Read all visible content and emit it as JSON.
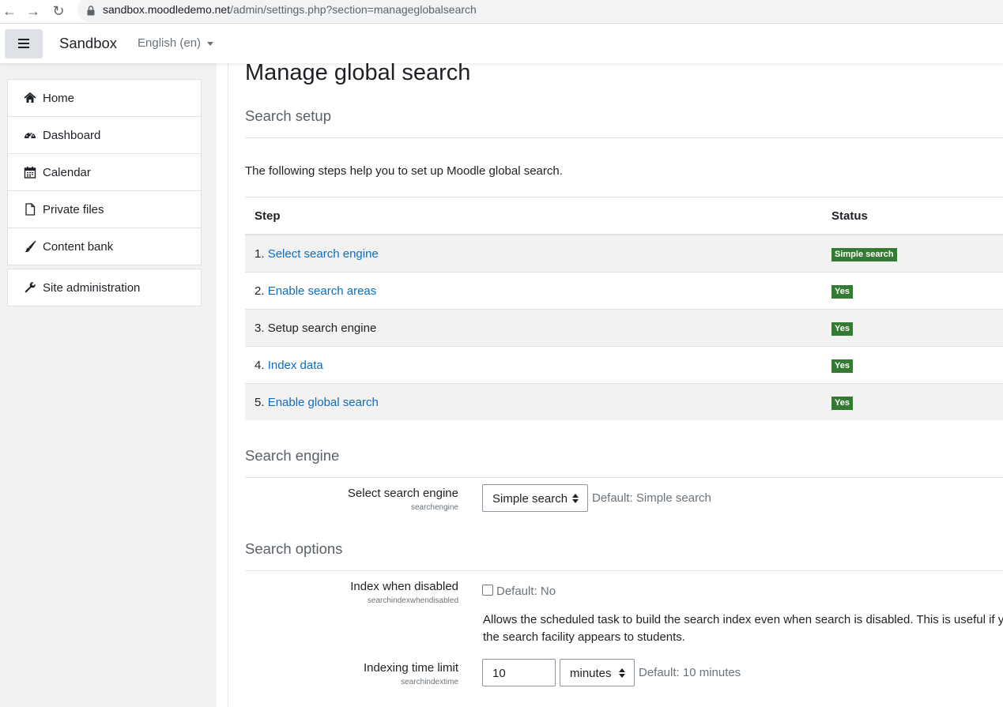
{
  "browser": {
    "url_domain": "sandbox.moodledemo.net",
    "url_path": "/admin/settings.php?section=manageglobalsearch"
  },
  "navbar": {
    "site_name": "Sandbox",
    "language": "English (en)"
  },
  "drawer": {
    "items": [
      {
        "label": "Home",
        "icon": "home-icon"
      },
      {
        "label": "Dashboard",
        "icon": "dashboard-icon"
      },
      {
        "label": "Calendar",
        "icon": "calendar-icon"
      },
      {
        "label": "Private files",
        "icon": "file-icon"
      },
      {
        "label": "Content bank",
        "icon": "paintbrush-icon"
      }
    ],
    "admin": {
      "label": "Site administration",
      "icon": "wrench-icon"
    }
  },
  "page": {
    "title": "Manage global search",
    "search_setup": {
      "heading": "Search setup",
      "intro": "The following steps help you to set up Moodle global search.",
      "columns": [
        "Step",
        "Status"
      ],
      "rows": [
        {
          "num": "1.",
          "label": "Select search engine",
          "is_link": true,
          "status": "Simple search"
        },
        {
          "num": "2.",
          "label": "Enable search areas",
          "is_link": true,
          "status": "Yes"
        },
        {
          "num": "3.",
          "label": "Setup search engine",
          "is_link": false,
          "status": "Yes"
        },
        {
          "num": "4.",
          "label": "Index data",
          "is_link": true,
          "status": "Yes"
        },
        {
          "num": "5.",
          "label": "Enable global search",
          "is_link": true,
          "status": "Yes"
        }
      ]
    },
    "search_engine": {
      "heading": "Search engine",
      "label": "Select search engine",
      "setting": "searchengine",
      "value": "Simple search",
      "default": "Default: Simple search"
    },
    "search_options": {
      "heading": "Search options",
      "index_disabled": {
        "label": "Index when disabled",
        "setting": "searchindexwhendisabled",
        "checked": false,
        "default": "Default: No",
        "description_line1": "Allows the scheduled task to build the search index even when search is disabled. This is useful if yo",
        "description_line2": "the search facility appears to students."
      },
      "time_limit": {
        "label": "Indexing time limit",
        "setting": "searchindextime",
        "value": "10",
        "unit": "minutes",
        "default": "Default: 10 minutes"
      }
    }
  },
  "colors": {
    "link": "#0f6cbf",
    "badge_success": "#357a32",
    "drawer_bg": "#f2f2f2"
  }
}
